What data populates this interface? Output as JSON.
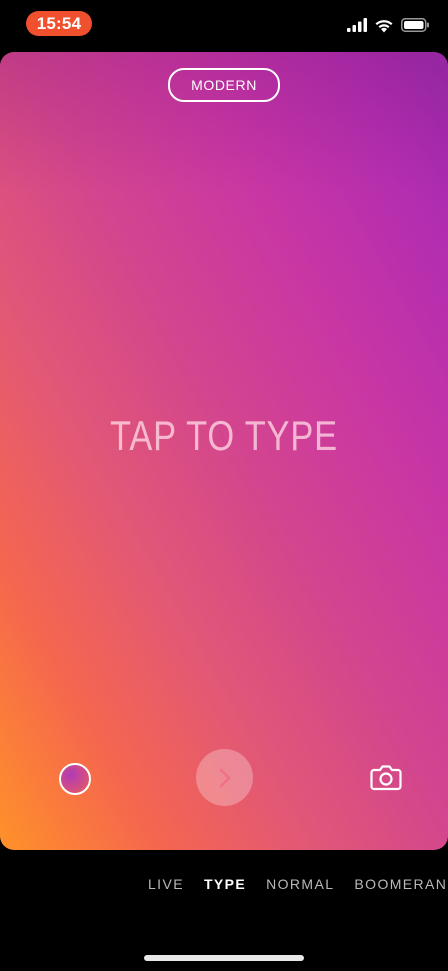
{
  "status_bar": {
    "time": "15:54",
    "icons": [
      "signal-icon",
      "wifi-icon",
      "battery-icon"
    ]
  },
  "canvas": {
    "style_label": "MODERN",
    "placeholder": "TAP TO TYPE",
    "gradient_colors": [
      "#ff9129",
      "#e25875",
      "#c936a4",
      "#9b2aae"
    ]
  },
  "controls": {
    "left": "color-picker-icon",
    "center": "chevron-right-icon",
    "right": "camera-icon"
  },
  "modes": {
    "items": [
      "LIVE",
      "TYPE",
      "NORMAL",
      "BOOMERANG"
    ],
    "active": "TYPE"
  },
  "colors": {
    "time_pill": "#f0502e",
    "background": "#000000",
    "mode_active": "#ffffff",
    "mode_inactive": "#b9b9b9"
  }
}
